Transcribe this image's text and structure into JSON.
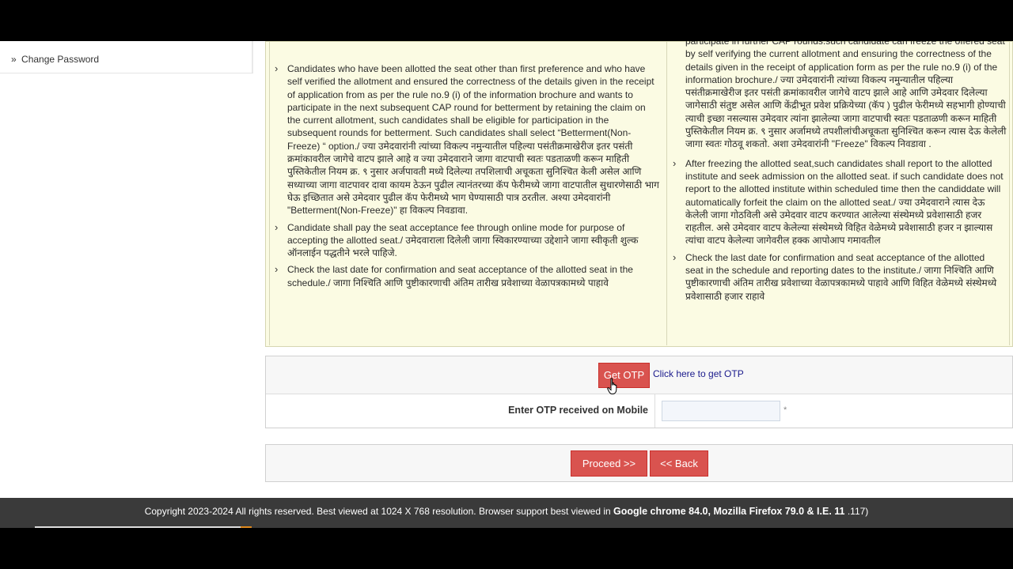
{
  "sidebar": {
    "change_password": "Change Password",
    "prefix": "»"
  },
  "instructions": {
    "bullet": "›",
    "left": [
      "Candidates who have been allotted the seat other than first preference and who have self verified the allotment and ensured the correctness of the details given in the receipt of application from as per the rule no.9 (i) of the information brochure and wants to participate in the next subsequent CAP round for betterment by retaining the claim on the current allotment, such candidates shall be eligible for participation in the subsequent rounds for betterment. Such candidates shall select “Betterment(Non-Freeze) “ option./ ज्या उमेदवारांनी त्यांच्या विकल्प नमुन्यातील पहिल्या पसंतीक्रमाखेरीज इतर पसंती क्रमांकावरील जागेचे वाटप झाले आहे व ज्या उमेदवाराने जागा वाटपाची स्वतः पडताळणी करून माहिती पुस्तिकेतील नियम क्र. ९ नुसार अर्जपावती मध्ये दिलेल्या तपशिलाची अचूकता सुनिश्चित केली असेल आणि सध्याच्या जागा वाटपावर दावा कायम ठेऊन पुढील त्यानंतरच्या कॅप फेरीमध्ये जागा वाटपातील सुधारणेसाठी भाग घेऊ इच्छितात असे उमेदवार पुढील कॅप फेरीमध्ये भाग घेण्यासाठी पात्र ठरतील. अश्या उमेदवारांनी \"Betterment(Non-Freeze)\" हा विकल्प निवडावा.",
      "Candidate shall pay the seat acceptance fee through online mode for purpose of accepting the allotted seat./ उमेदवाराला दिलेली जागा स्विकारण्याच्या उद्देशाने जागा स्वीकृती शुल्क ऑनलाईन पद्धतीने भरले पाहिजे.",
      "Check the last date for confirmation and seat acceptance of the allotted seat in the schedule./ जागा निश्चिति आणि पुष्टीकारणाची अंतिम तारीख प्रवेशाच्या वेळापत्रकामध्ये पाहावे"
    ],
    "right_partial": "participate in further CAP rounds.such candidate can freeze the offered seat by self verifying the current allotment and ensuring the correctness of the details given in the receipt of application form as per the rule no.9 (i) of the information brochure./ ज्या उमेदवारांनी त्यांच्या विकल्प नमुन्यातील पहिल्या पसंतीक्रमाखेरीज इतर पसंती क्रमांकावरील जागेचे वाटप झाले आहे आणि उमेदवार दिलेल्या जागेसाठी संतुष्ट असेल आणि केंद्रीभूत प्रवेश प्रक्रियेच्या (कॅप ) पुढील फेरीमध्ये सहभागी होण्याची त्याची इच्छा नसल्यास उमेदवार त्यांना झालेल्या जागा वाटपाची स्वतः पडताळणी करून माहिती पुस्तिकेतील नियम क्र. ९ नुसार अर्जामध्ये तपशीलांचीअचूकता सुनिश्चित करून त्यास देऊ केलेली जागा स्वतः गोठवू शकतो. अशा उमेदवारांनी \"Freeze\" विकल्प निवडावा .",
    "right": [
      "After freezing the allotted seat,such candidates shall report to the allotted institute and seek admission on the allotted seat. if such candidate does not report to the allotted institute within scheduled time then the candiddate will automatically forfeit the claim on the allotted seat./ ज्या उमेदवाराने त्यास देऊ केलेली जागा गोठविली असे उमेदवार वाटप करण्यात आलेल्या संस्थेमध्ये प्रवेशासाठी हजर राहतील. असे उमेदवार वाटप केलेल्या संस्थेमध्ये विहित वेळेमध्ये प्रवेशासाठी हजर न झाल्यास त्यांचा वाटप केलेल्या जागेवरील हक्क आपोआप गमावतील",
      "Check the last date for confirmation and seat acceptance of the allotted seat in the schedule and reporting dates to the institute./ जागा निश्चिति आणि पुष्टीकारणाची अंतिम तारीख प्रवेशाच्या वेळापत्रकामध्ये पाहावे आणि विहित वेळेमध्ये संस्थेमध्ये प्रवेशासाठी हजार राहावे"
    ]
  },
  "otp": {
    "button_label": "Get OTP",
    "hint": "Click here to get OTP",
    "field_label": "Enter OTP received on Mobile",
    "input_value": "",
    "required_mark": "*"
  },
  "actions": {
    "proceed": "Proceed >>",
    "back": "<< Back"
  },
  "footer": {
    "text": "Copyright 2023-2024 All rights reserved. Best viewed at 1024 X 768 resolution. Browser support best viewed in ",
    "browsers": "Google chrome 84.0, Mozilla Firefox 79.0 & I.E. 11",
    "suffix": " .117)"
  },
  "colors": {
    "panel_bg": "#fbfbe3",
    "button_red": "#d9534f",
    "footer_bg": "#3a3a3a",
    "link_blue": "#1a1a8c"
  }
}
